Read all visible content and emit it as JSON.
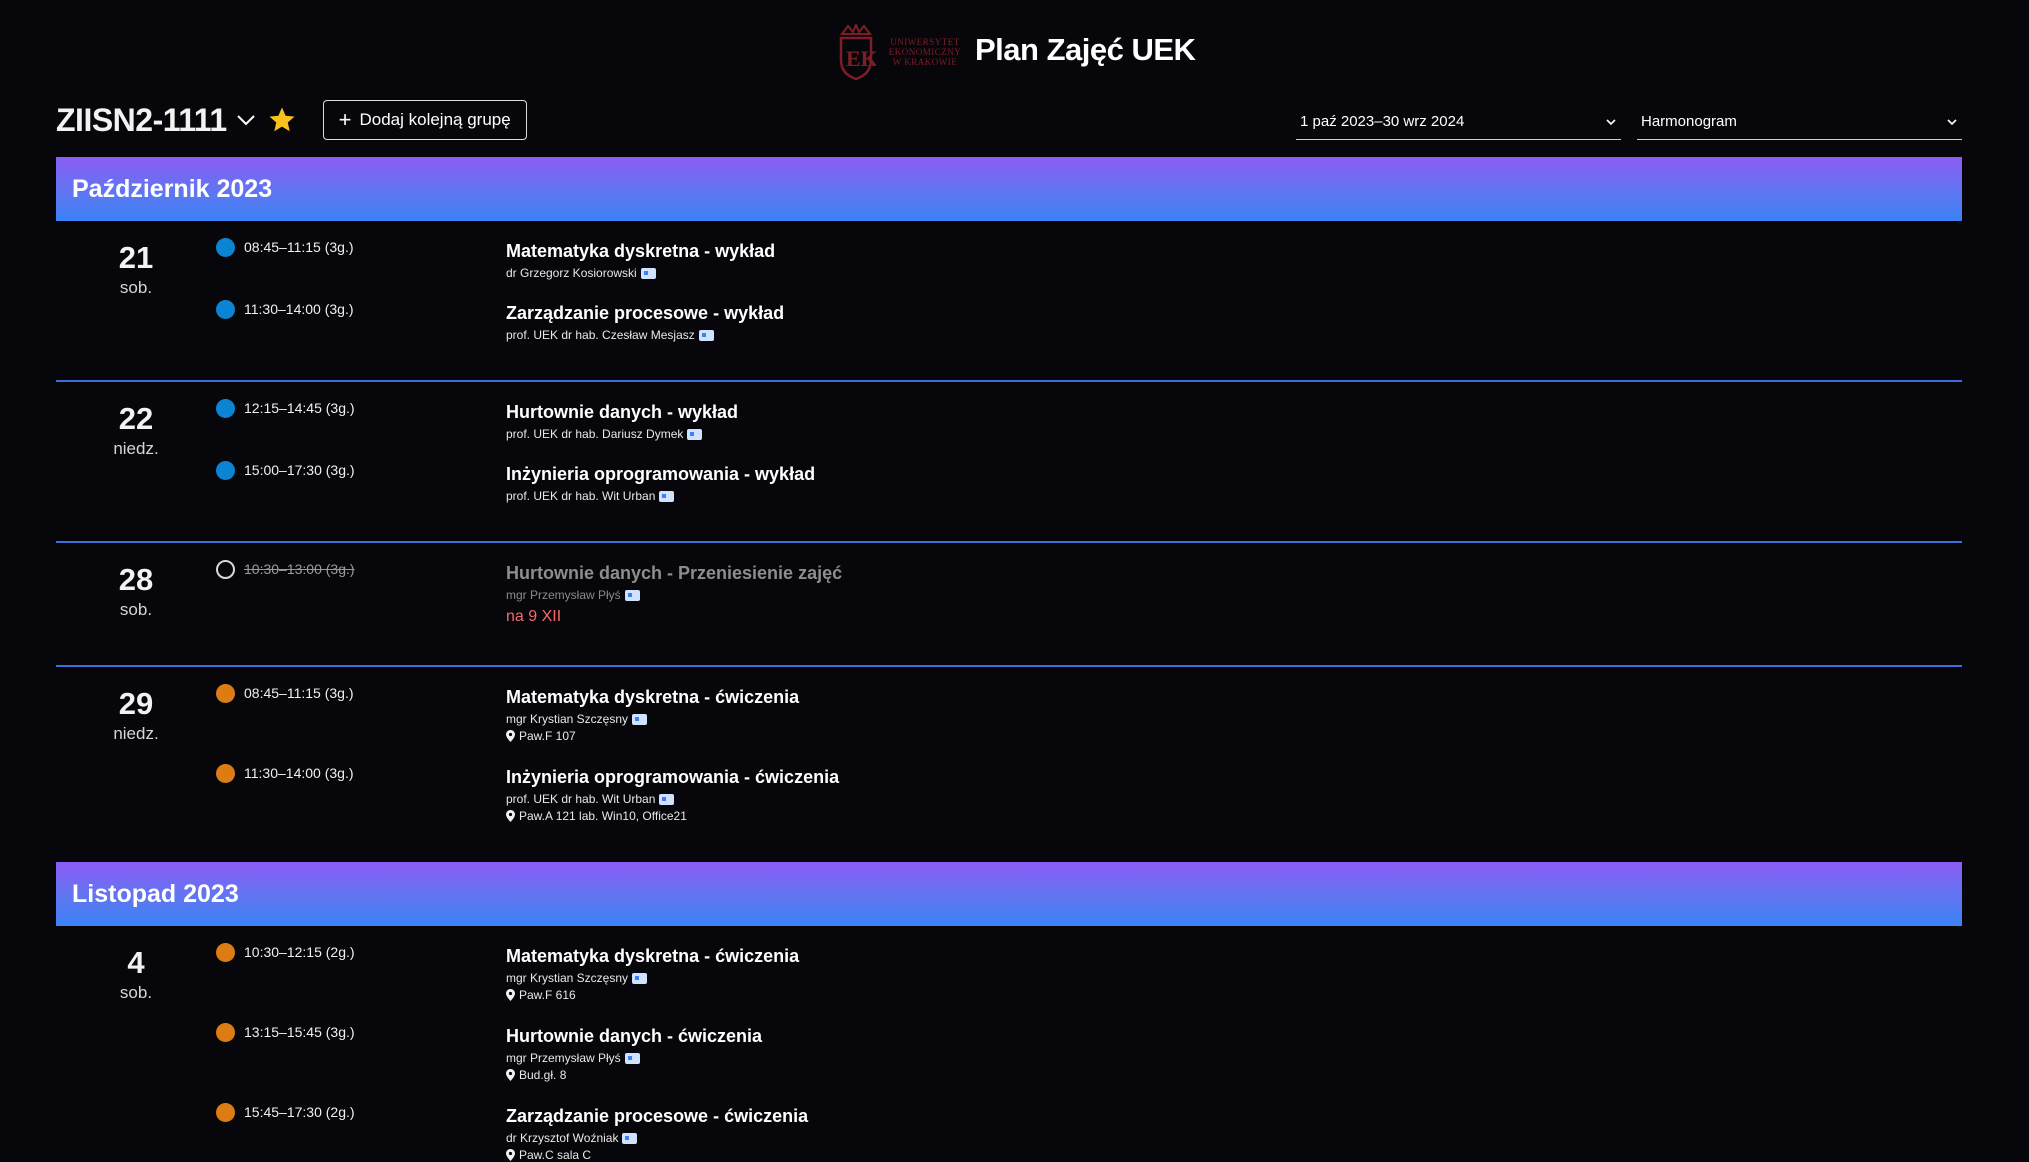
{
  "header": {
    "logo_text": "Uniwersytet Ekonomiczny w Krakowie",
    "title": "Plan Zajęć UEK",
    "logo_color": "#7c1e27"
  },
  "group": {
    "name": "ZIISN2-1111",
    "dropdown_icon": "chevron-down-icon",
    "favorite_icon": "star-icon",
    "add_button_label": "Dodaj kolejną grupę"
  },
  "filters": {
    "range": "1 paź 2023–30 wrz 2024",
    "view": "Harmonogram"
  },
  "colors": {
    "month_gradient_top": "#8b5cf6",
    "month_gradient_bottom": "#3b82f6",
    "lecture_dot": "#0b84d4",
    "exercise_dot": "#dd7c12",
    "separator": "#3b6fe0",
    "note": "#f26b6b"
  },
  "months": [
    {
      "label": "Październik 2023",
      "days": [
        {
          "num": "21",
          "weekday": "sob.",
          "events": [
            {
              "time": "08:45–11:15 (3g.)",
              "title": "Matematyka dyskretna - wykład",
              "teacher": "dr Grzegorz Kosiorowski"
            },
            {
              "time": "11:30–14:00 (3g.)",
              "title": "Zarządzanie procesowe - wykład",
              "teacher": "prof. UEK dr hab. Czesław Mesjasz"
            }
          ]
        },
        {
          "num": "22",
          "weekday": "niedz.",
          "events": [
            {
              "time": "12:15–14:45 (3g.)",
              "title": "Hurtownie danych - wykład",
              "teacher": "prof. UEK dr hab. Dariusz Dymek"
            },
            {
              "time": "15:00–17:30 (3g.)",
              "title": "Inżynieria oprogramowania - wykład",
              "teacher": "prof. UEK dr hab. Wit Urban"
            }
          ]
        },
        {
          "num": "28",
          "weekday": "sob.",
          "events": [
            {
              "time": "10:30–13:00 (3g.)",
              "title": "Hurtownie danych - Przeniesienie zajęć",
              "teacher": "mgr Przemysław Płyś",
              "note": "na 9 XII"
            }
          ]
        },
        {
          "num": "29",
          "weekday": "niedz.",
          "events": [
            {
              "time": "08:45–11:15 (3g.)",
              "title": "Matematyka dyskretna - ćwiczenia",
              "teacher": "mgr Krystian Szczęsny",
              "room": "Paw.F 107"
            },
            {
              "time": "11:30–14:00 (3g.)",
              "title": "Inżynieria oprogramowania - ćwiczenia",
              "teacher": "prof. UEK dr hab. Wit Urban",
              "room": "Paw.A 121 lab. Win10, Office21"
            }
          ]
        }
      ]
    },
    {
      "label": "Listopad 2023",
      "days": [
        {
          "num": "4",
          "weekday": "sob.",
          "events": [
            {
              "time": "10:30–12:15 (2g.)",
              "title": "Matematyka dyskretna - ćwiczenia",
              "teacher": "mgr Krystian Szczęsny",
              "room": "Paw.F 616"
            },
            {
              "time": "13:15–15:45 (3g.)",
              "title": "Hurtownie danych - ćwiczenia",
              "teacher": "mgr Przemysław Płyś",
              "room": "Bud.gł. 8"
            },
            {
              "time": "15:45–17:30 (2g.)",
              "title": "Zarządzanie procesowe - ćwiczenia",
              "teacher": "dr Krzysztof Woźniak",
              "room": "Paw.C sala C"
            }
          ]
        }
      ]
    }
  ]
}
